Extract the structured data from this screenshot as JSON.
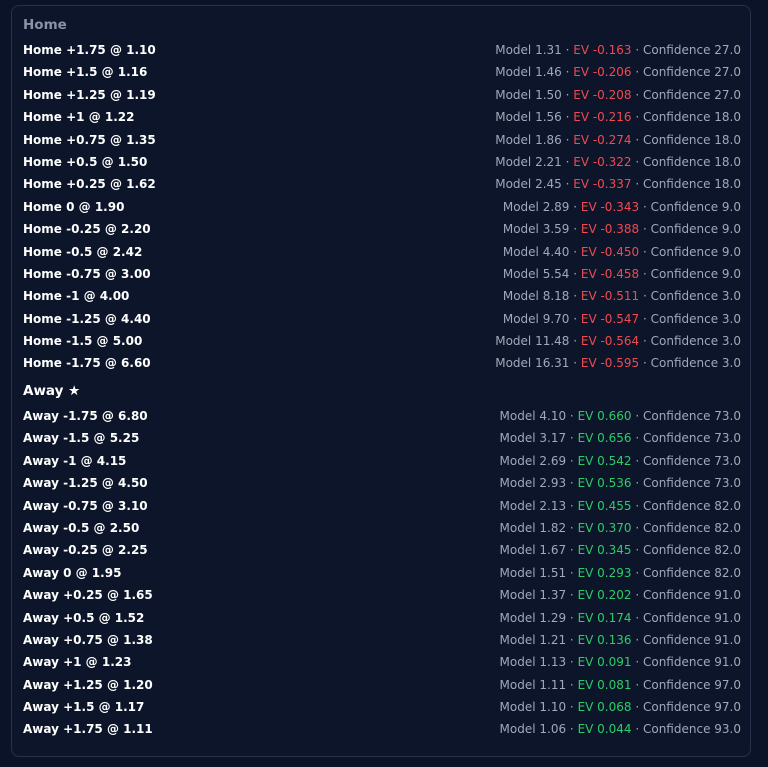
{
  "sections": {
    "home": {
      "title": "Home",
      "rows": [
        {
          "bet": "Home +1.75 @ 1.10",
          "model": "Model 1.31",
          "ev": "EV -0.163",
          "confidence": "Confidence 27.0"
        },
        {
          "bet": "Home +1.5 @ 1.16",
          "model": "Model 1.46",
          "ev": "EV -0.206",
          "confidence": "Confidence 27.0"
        },
        {
          "bet": "Home +1.25 @ 1.19",
          "model": "Model 1.50",
          "ev": "EV -0.208",
          "confidence": "Confidence 27.0"
        },
        {
          "bet": "Home +1 @ 1.22",
          "model": "Model 1.56",
          "ev": "EV -0.216",
          "confidence": "Confidence 18.0"
        },
        {
          "bet": "Home +0.75 @ 1.35",
          "model": "Model 1.86",
          "ev": "EV -0.274",
          "confidence": "Confidence 18.0"
        },
        {
          "bet": "Home +0.5 @ 1.50",
          "model": "Model 2.21",
          "ev": "EV -0.322",
          "confidence": "Confidence 18.0"
        },
        {
          "bet": "Home +0.25 @ 1.62",
          "model": "Model 2.45",
          "ev": "EV -0.337",
          "confidence": "Confidence 18.0"
        },
        {
          "bet": "Home 0 @ 1.90",
          "model": "Model 2.89",
          "ev": "EV -0.343",
          "confidence": "Confidence 9.0"
        },
        {
          "bet": "Home -0.25 @ 2.20",
          "model": "Model 3.59",
          "ev": "EV -0.388",
          "confidence": "Confidence 9.0"
        },
        {
          "bet": "Home -0.5 @ 2.42",
          "model": "Model 4.40",
          "ev": "EV -0.450",
          "confidence": "Confidence 9.0"
        },
        {
          "bet": "Home -0.75 @ 3.00",
          "model": "Model 5.54",
          "ev": "EV -0.458",
          "confidence": "Confidence 9.0"
        },
        {
          "bet": "Home -1 @ 4.00",
          "model": "Model 8.18",
          "ev": "EV -0.511",
          "confidence": "Confidence 3.0"
        },
        {
          "bet": "Home -1.25 @ 4.40",
          "model": "Model 9.70",
          "ev": "EV -0.547",
          "confidence": "Confidence 3.0"
        },
        {
          "bet": "Home -1.5 @ 5.00",
          "model": "Model 11.48",
          "ev": "EV -0.564",
          "confidence": "Confidence 3.0"
        },
        {
          "bet": "Home -1.75 @ 6.60",
          "model": "Model 16.31",
          "ev": "EV -0.595",
          "confidence": "Confidence 3.0"
        }
      ]
    },
    "away": {
      "title": "Away ★",
      "rows": [
        {
          "bet": "Away -1.75 @ 6.80",
          "model": "Model 4.10",
          "ev": "EV 0.660",
          "confidence": "Confidence 73.0"
        },
        {
          "bet": "Away -1.5 @ 5.25",
          "model": "Model 3.17",
          "ev": "EV 0.656",
          "confidence": "Confidence 73.0"
        },
        {
          "bet": "Away -1 @ 4.15",
          "model": "Model 2.69",
          "ev": "EV 0.542",
          "confidence": "Confidence 73.0"
        },
        {
          "bet": "Away -1.25 @ 4.50",
          "model": "Model 2.93",
          "ev": "EV 0.536",
          "confidence": "Confidence 73.0"
        },
        {
          "bet": "Away -0.75 @ 3.10",
          "model": "Model 2.13",
          "ev": "EV 0.455",
          "confidence": "Confidence 82.0"
        },
        {
          "bet": "Away -0.5 @ 2.50",
          "model": "Model 1.82",
          "ev": "EV 0.370",
          "confidence": "Confidence 82.0"
        },
        {
          "bet": "Away -0.25 @ 2.25",
          "model": "Model 1.67",
          "ev": "EV 0.345",
          "confidence": "Confidence 82.0"
        },
        {
          "bet": "Away 0 @ 1.95",
          "model": "Model 1.51",
          "ev": "EV 0.293",
          "confidence": "Confidence 82.0"
        },
        {
          "bet": "Away +0.25 @ 1.65",
          "model": "Model 1.37",
          "ev": "EV 0.202",
          "confidence": "Confidence 91.0"
        },
        {
          "bet": "Away +0.5 @ 1.52",
          "model": "Model 1.29",
          "ev": "EV 0.174",
          "confidence": "Confidence 91.0"
        },
        {
          "bet": "Away +0.75 @ 1.38",
          "model": "Model 1.21",
          "ev": "EV 0.136",
          "confidence": "Confidence 91.0"
        },
        {
          "bet": "Away +1 @ 1.23",
          "model": "Model 1.13",
          "ev": "EV 0.091",
          "confidence": "Confidence 91.0"
        },
        {
          "bet": "Away +1.25 @ 1.20",
          "model": "Model 1.11",
          "ev": "EV 0.081",
          "confidence": "Confidence 97.0"
        },
        {
          "bet": "Away +1.5 @ 1.17",
          "model": "Model 1.10",
          "ev": "EV 0.068",
          "confidence": "Confidence 97.0"
        },
        {
          "bet": "Away +1.75 @ 1.11",
          "model": "Model 1.06",
          "ev": "EV 0.044",
          "confidence": "Confidence 93.0"
        }
      ]
    }
  },
  "separator": " · ",
  "colors": {
    "negative_ev": "#f04a52",
    "positive_ev": "#2ecc68",
    "muted_text": "#a0a9ba",
    "home_title": "#8a93a6"
  }
}
